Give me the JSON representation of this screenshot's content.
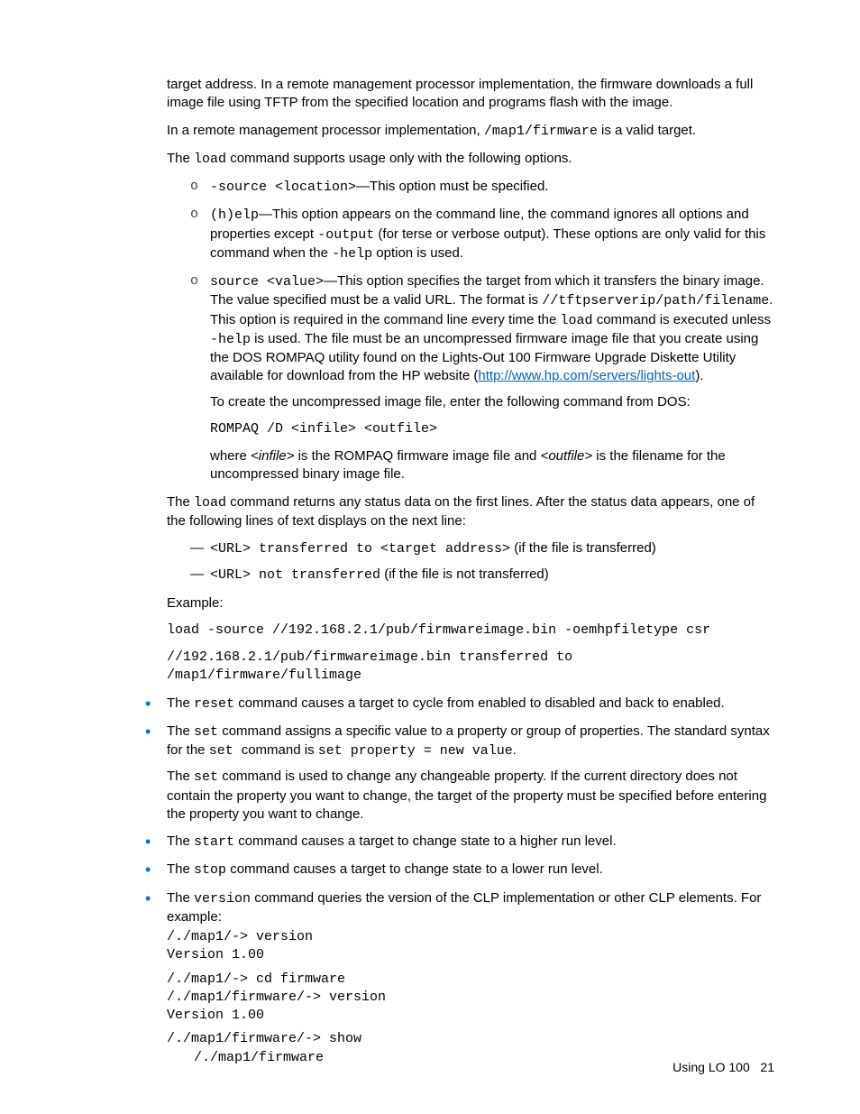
{
  "p_intro_1": "target address. In a remote management processor implementation, the firmware downloads a full image file using TFTP from the specified location and programs flash with the image.",
  "p_intro_2_pre": "In a remote management processor implementation, ",
  "p_intro_2_code": "/map1/firmware",
  "p_intro_2_post": " is a valid target.",
  "p_intro_3_pre": "The ",
  "p_intro_3_code": "load",
  "p_intro_3_post": " command supports usage only with the following options.",
  "opt1_code": "-source <location>",
  "opt1_text": "—This option must be specified.",
  "opt2_code1": "(h)elp",
  "opt2_text1": "—This option appears on the command line, the command ignores all options and properties except ",
  "opt2_code2": "-output",
  "opt2_text2": " (for terse or verbose output). These options are only valid for this command when the ",
  "opt2_code3": "-help",
  "opt2_text3": " option is used.",
  "opt3_code1": "source <value>",
  "opt3_text1": "—This option specifies the target from which it transfers the binary image. The value specified must be a valid URL. The format is ",
  "opt3_code2": "//tftpserverip/path/filename",
  "opt3_text2": ". This option is required in the command line every time the ",
  "opt3_code3": "load",
  "opt3_text3": " command is executed unless ",
  "opt3_code4": "-help",
  "opt3_text4": " is used. The file must be an uncompressed firmware image file that you create using the DOS ROMPAQ utility found on the Lights-Out 100 Firmware Upgrade Diskette Utility available for download from the HP website (",
  "opt3_link": "http://www.hp.com/servers/lights-out",
  "opt3_text5": ").",
  "opt3_sub1": "To create the uncompressed image file, enter the following command from DOS:",
  "opt3_sub2": "ROMPAQ /D <infile> <outfile>",
  "opt3_sub3_pre": "where ",
  "opt3_sub3_i1": "<infile>",
  "opt3_sub3_mid": " is the ROMPAQ firmware image file and ",
  "opt3_sub3_i2": "<outfile>",
  "opt3_sub3_post": " is the filename for the uncompressed binary image file.",
  "p_after_opts_pre": "The ",
  "p_after_opts_code": "load",
  "p_after_opts_post": " command returns any status data on the first lines. After the status data appears, one of the following lines of text displays on the next line:",
  "dash1_code": "<URL> transferred to <target address>",
  "dash1_text": " (if the file is transferred)",
  "dash2_code": "<URL> not transferred",
  "dash2_text": " (if the file is not transferred)",
  "example_label": "Example:",
  "example_line1": "load -source //192.168.2.1/pub/firmwareimage.bin -oemhpfiletype csr",
  "example_line2": "//192.168.2.1/pub/firmwareimage.bin transferred to /map1/firmware/fullimage",
  "b_reset_pre": "The ",
  "b_reset_code": "reset",
  "b_reset_post": " command causes a target to cycle from enabled to disabled and back to enabled.",
  "b_set1_pre": "The ",
  "b_set1_code1": "set",
  "b_set1_mid1": " command assigns a specific value to a property or group of properties. The standard syntax for the ",
  "b_set1_code2": "set ",
  "b_set1_mid2": " command is ",
  "b_set1_code3": "set property = new value",
  "b_set1_end": ".",
  "b_set2_pre": "The ",
  "b_set2_code": "set",
  "b_set2_post": " command is used to change any changeable property. If the current directory does not contain the property you want to change, the target of the property must be specified before entering the property you want to change.",
  "b_start_pre": "The ",
  "b_start_code": "start",
  "b_start_post": " command causes a target to change state to a higher run level.",
  "b_stop_pre": "The ",
  "b_stop_code": "stop",
  "b_stop_post": " command causes a target to change state to a lower run level.",
  "b_version_pre": "The ",
  "b_version_code": "version",
  "b_version_post": " command queries the version of the CLP implementation or other CLP elements. For example:",
  "v_line1": "/./map1/-> version",
  "v_line2": "Version 1.00",
  "v_line3": "/./map1/-> cd firmware",
  "v_line4": "/./map1/firmware/-> version",
  "v_line5": "Version 1.00",
  "v_line6": "/./map1/firmware/-> show",
  "v_line7": "/./map1/firmware",
  "footer_text": "Using LO 100",
  "footer_page": "21"
}
